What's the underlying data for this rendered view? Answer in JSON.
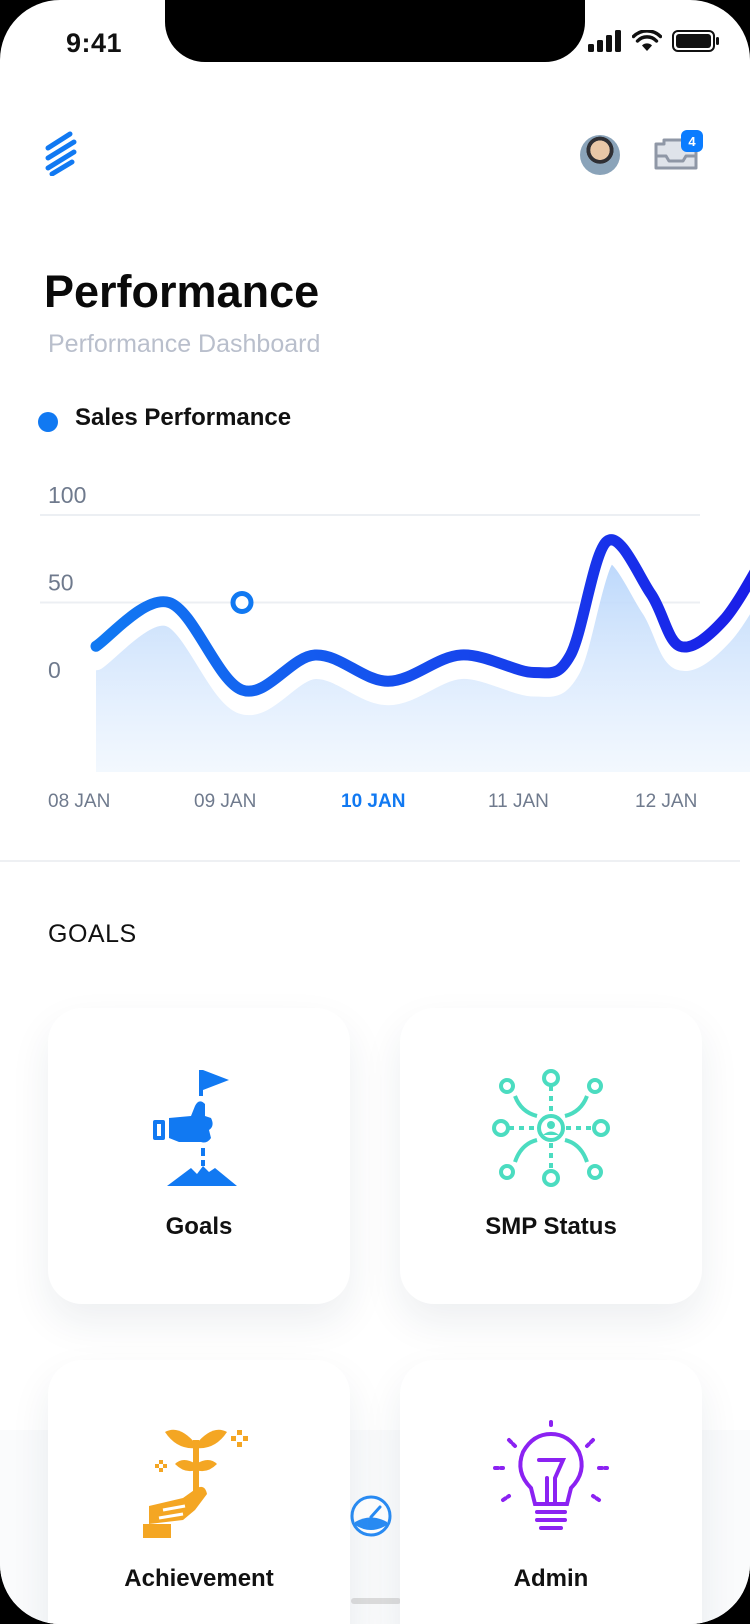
{
  "status_bar": {
    "time": "9:41"
  },
  "header": {
    "notification_count": "4"
  },
  "page": {
    "title": "Performance",
    "subtitle": "Performance Dashboard"
  },
  "chart_data": {
    "type": "area",
    "legend": "Sales Performance",
    "y_ticks": [
      "100",
      "50",
      "0"
    ],
    "x_labels": [
      "08 JAN",
      "09 JAN",
      "10 JAN",
      "11 JAN",
      "12 JAN"
    ],
    "active_x": "10 JAN",
    "x": [
      0,
      0.5,
      1,
      1.5,
      2,
      2.5,
      3,
      3.25,
      3.5,
      3.8,
      4.0,
      4.3,
      4.6
    ],
    "values": [
      25,
      50,
      0,
      20,
      5,
      20,
      10,
      20,
      85,
      55,
      25,
      40,
      80
    ],
    "series": [
      {
        "name": "Sales Performance",
        "color": "#1a3cf5"
      }
    ],
    "ylim": [
      0,
      100
    ],
    "highlight_point": {
      "x": 1,
      "y": 50
    },
    "grid": true,
    "colors": {
      "line_start": "#1179f2",
      "line_end": "#1a1ce8",
      "fill": "#b9d6fb"
    }
  },
  "goals": {
    "section_title": "GOALS",
    "cards": [
      {
        "label": "Goals",
        "icon": "flag-on-mountain-icon",
        "color": "#1179f2"
      },
      {
        "label": "SMP Status",
        "icon": "network-people-icon",
        "color": "#4bdcc0"
      },
      {
        "label": "Achievement",
        "icon": "growing-plant-hand-icon",
        "color": "#f4a623"
      },
      {
        "label": "Admin",
        "icon": "lightbulb-icon",
        "color": "#8b22f2"
      }
    ]
  }
}
